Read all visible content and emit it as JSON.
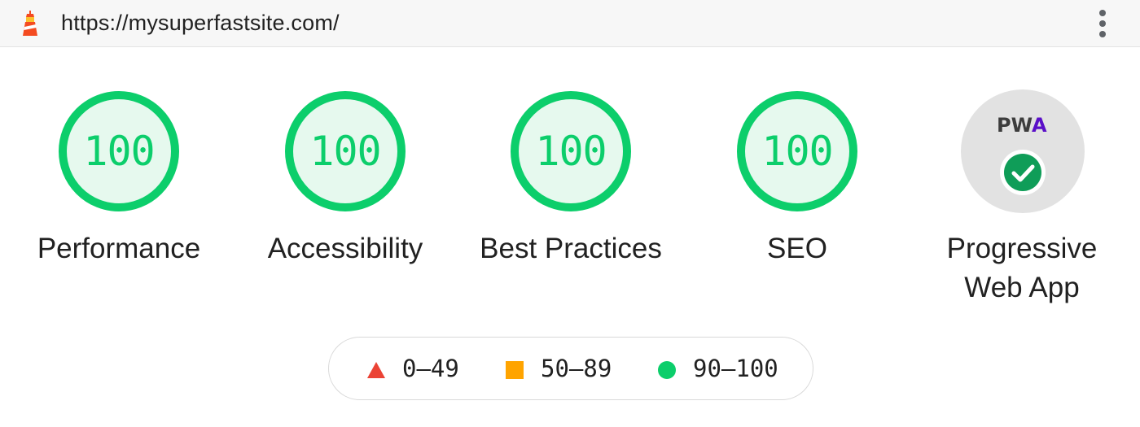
{
  "browser": {
    "url": "https://mysuperfastsite.com/",
    "logo_icon": "lighthouse-icon",
    "menu_icon": "more-vert-icon"
  },
  "categories": [
    {
      "label": "Performance",
      "score": "100",
      "value": 100
    },
    {
      "label": "Accessibility",
      "score": "100",
      "value": 100
    },
    {
      "label": "Best Practices",
      "score": "100",
      "value": 100
    },
    {
      "label": "SEO",
      "score": "100",
      "value": 100
    }
  ],
  "pwa": {
    "badge_text": "PWA",
    "label_line1": "Progressive",
    "label_line2": "Web App",
    "status_icon": "check-icon"
  },
  "legend": [
    {
      "range": "0–49",
      "shape": "triangle",
      "color": "#eb4335"
    },
    {
      "range": "50–89",
      "shape": "square",
      "color": "#ffa400"
    },
    {
      "range": "90–100",
      "shape": "circle",
      "color": "#0cce6b"
    }
  ],
  "colors": {
    "pass": "#0cce6b",
    "pass_fill": "#e6f9ee",
    "average": "#ffa400",
    "fail": "#eb4335",
    "pwa_bg": "#e2e2e2",
    "pwa_check": "#0f9d58",
    "pwa_blue": "#5a0fc8",
    "pwa_dark": "#3d3d3d"
  }
}
